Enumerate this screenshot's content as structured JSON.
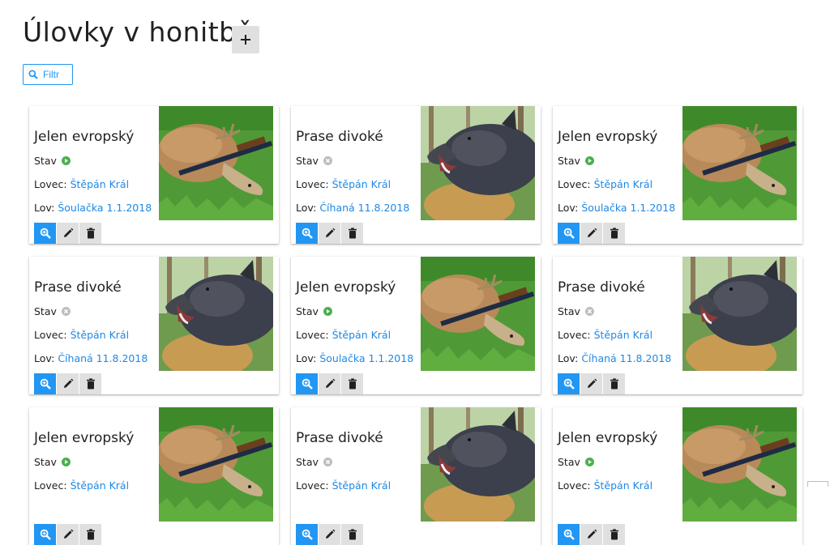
{
  "page": {
    "title": "Úlovky v honitbě"
  },
  "toolbar": {
    "add_label": "+",
    "filter_label": "Filtr"
  },
  "labels": {
    "status": "Stav",
    "hunter": "Lovec:",
    "hunt": "Lov:"
  },
  "colors": {
    "accent": "#2196f3",
    "link": "#1e88e5",
    "status_active": "#4caf50",
    "status_inactive": "#bdbdbd"
  },
  "cards": [
    {
      "title": "Jelen evropský",
      "status": "active",
      "hunter": "Štěpán Král",
      "hunt": "Šoulačka 1.1.2018",
      "image": "deer"
    },
    {
      "title": "Prase divoké",
      "status": "inactive",
      "hunter": "Štěpán Král",
      "hunt": "Číhaná 11.8.2018",
      "image": "boar"
    },
    {
      "title": "Jelen evropský",
      "status": "active",
      "hunter": "Štěpán Král",
      "hunt": "Šoulačka 1.1.2018",
      "image": "deer"
    },
    {
      "title": "Prase divoké",
      "status": "inactive",
      "hunter": "Štěpán Král",
      "hunt": "Číhaná 11.8.2018",
      "image": "boar"
    },
    {
      "title": "Jelen evropský",
      "status": "active",
      "hunter": "Štěpán Král",
      "hunt": "Šoulačka 1.1.2018",
      "image": "deer"
    },
    {
      "title": "Prase divoké",
      "status": "inactive",
      "hunter": "Štěpán Král",
      "hunt": "Číhaná 11.8.2018",
      "image": "boar"
    },
    {
      "title": "Jelen evropský",
      "status": "active",
      "hunter": "Štěpán Král",
      "hunt": "",
      "image": "deer"
    },
    {
      "title": "Prase divoké",
      "status": "inactive",
      "hunter": "Štěpán Král",
      "hunt": "",
      "image": "boar"
    },
    {
      "title": "Jelen evropský",
      "status": "active",
      "hunter": "Štěpán Král",
      "hunt": "",
      "image": "deer"
    }
  ]
}
